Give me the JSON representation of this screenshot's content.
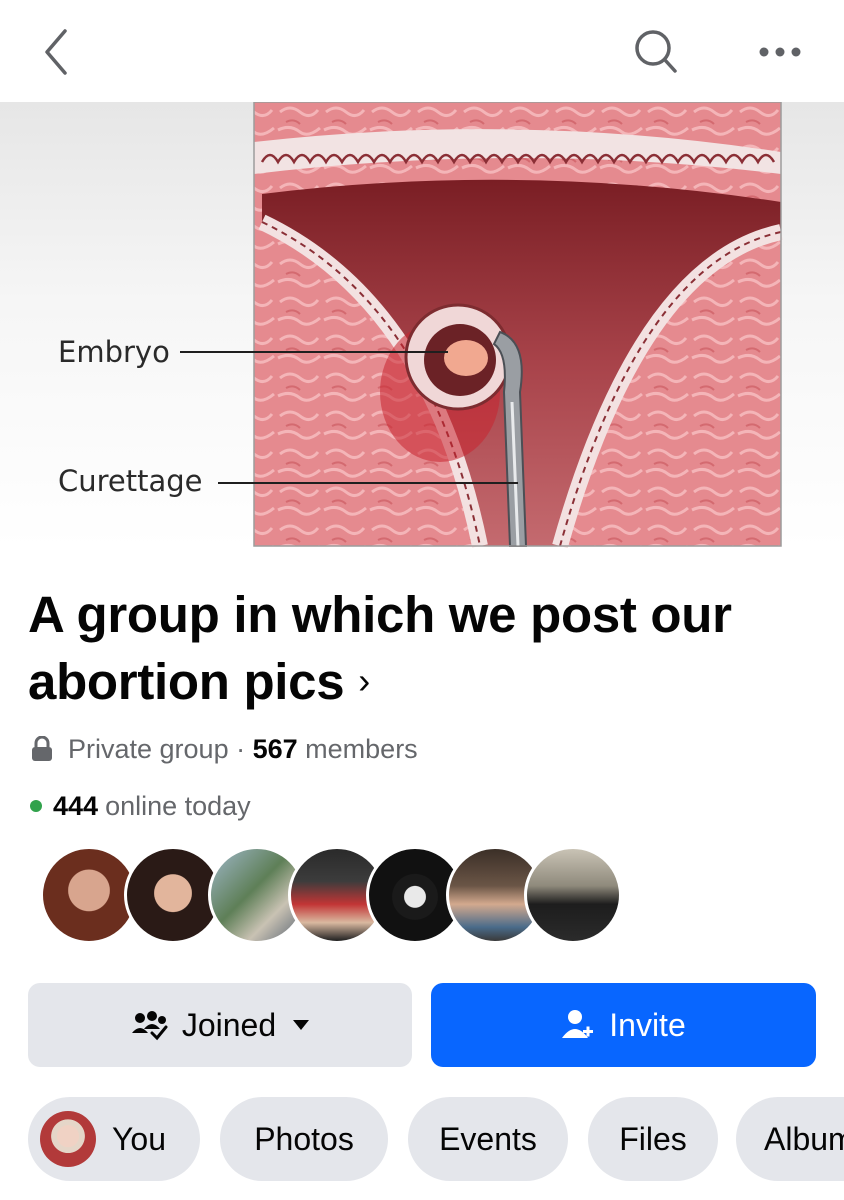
{
  "header": {
    "back_icon": "chevron-left-icon",
    "search_icon": "search-icon",
    "more_icon": "more-horizontal-icon"
  },
  "cover": {
    "labels": [
      "Embryo",
      "Curettage"
    ]
  },
  "group": {
    "title": "A group in which we post our abortion pics",
    "privacy": "Private group",
    "separator": " · ",
    "member_count": "567",
    "members_label": " members",
    "online_count": "444",
    "online_label": "online today"
  },
  "buttons": {
    "joined": "Joined",
    "invite": "Invite"
  },
  "tabs": [
    "You",
    "Photos",
    "Events",
    "Files",
    "Albums"
  ],
  "colors": {
    "accent": "#0866ff",
    "button_gray": "#e4e6eb",
    "online": "#31a24c",
    "secondary_text": "#65676b"
  }
}
